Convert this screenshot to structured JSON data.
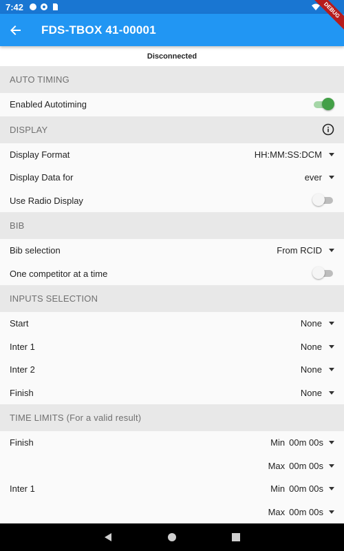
{
  "statusbar": {
    "time": "7:42"
  },
  "debug_banner": "DEBUG",
  "appbar": {
    "title": "FDS-TBOX 41-00001"
  },
  "connection_status": "Disconnected",
  "sections": {
    "auto_timing": {
      "header": "AUTO TIMING",
      "enabled_label": "Enabled Autotiming",
      "enabled_on": true
    },
    "display": {
      "header": "DISPLAY",
      "format_label": "Display Format",
      "format_value": "HH:MM:SS:DCM",
      "data_for_label": "Display Data for",
      "data_for_value": "ever",
      "radio_label": "Use Radio Display",
      "radio_on": false
    },
    "bib": {
      "header": "BIB",
      "selection_label": "Bib selection",
      "selection_value": "From RCID",
      "one_competitor_label": "One competitor at a time",
      "one_competitor_on": false
    },
    "inputs": {
      "header": "INPUTS SELECTION",
      "rows": [
        {
          "label": "Start",
          "value": "None"
        },
        {
          "label": "Inter 1",
          "value": "None"
        },
        {
          "label": "Inter 2",
          "value": "None"
        },
        {
          "label": "Finish",
          "value": "None"
        }
      ]
    },
    "time_limits": {
      "header": "TIME LIMITS (For a valid result)",
      "rows": [
        {
          "label": "Finish",
          "min_label": "Min",
          "min_value": "00m 00s",
          "max_label": "Max",
          "max_value": "00m 00s"
        },
        {
          "label": "Inter 1",
          "min_label": "Min",
          "min_value": "00m 00s",
          "max_label": "Max",
          "max_value": "00m 00s"
        }
      ]
    }
  },
  "colors": {
    "appbar": "#2196f3",
    "statusbar": "#1976d2",
    "switch_on": "#43a047"
  }
}
